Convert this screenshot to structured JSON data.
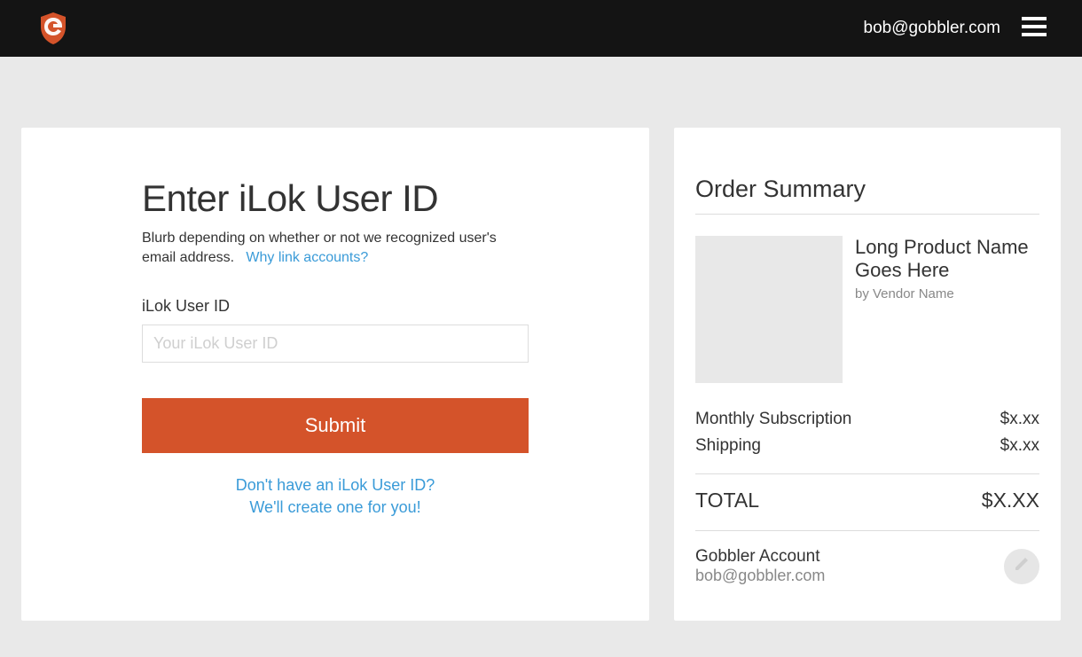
{
  "header": {
    "user_email": "bob@gobbler.com"
  },
  "form": {
    "title": "Enter iLok User ID",
    "blurb": "Blurb depending on whether or not we recognized user's email address.",
    "why_link_label": "Why link accounts?",
    "field_label": "iLok User ID",
    "field_placeholder": "Your iLok User ID",
    "submit_label": "Submit",
    "no_ilok_line1": "Don't have an iLok User ID?",
    "no_ilok_line2": "We'll create one for you!"
  },
  "summary": {
    "title": "Order Summary",
    "product_name": "Long Product Name Goes Here",
    "vendor_line": "by Vendor Name",
    "lines": [
      {
        "label": "Monthly Subscription",
        "value": "$x.xx"
      },
      {
        "label": "Shipping",
        "value": "$x.xx"
      }
    ],
    "total_label": "TOTAL",
    "total_value": "$X.XX",
    "account_label": "Gobbler Account",
    "account_email": "bob@gobbler.com"
  },
  "colors": {
    "accent": "#d4532a",
    "link": "#3a9bd8"
  }
}
